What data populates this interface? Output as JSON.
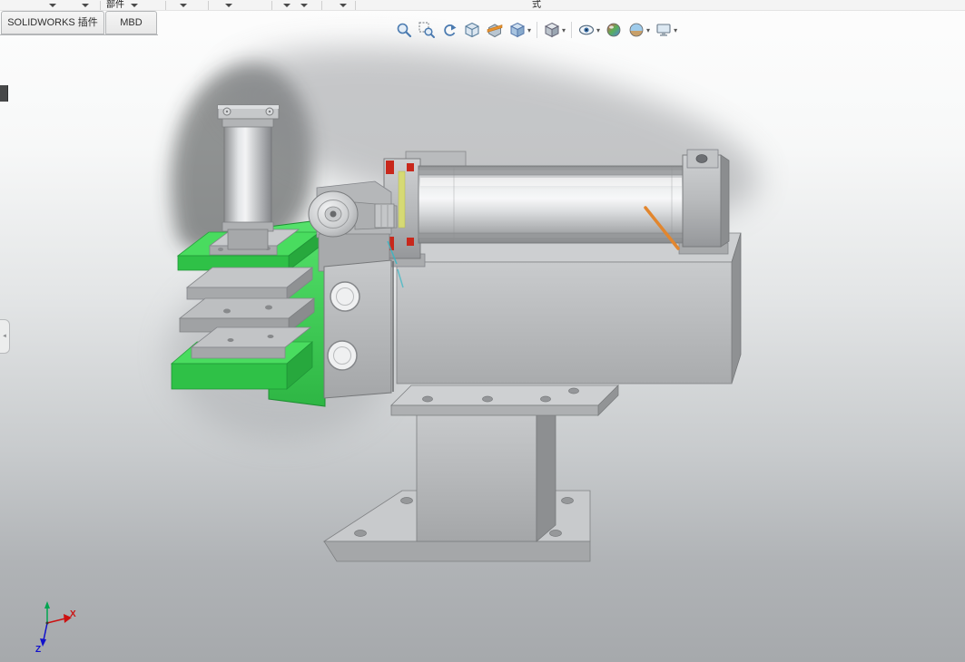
{
  "command_bar": {
    "component_label": "部件",
    "mode_label": "式"
  },
  "tab_bar": {
    "tabs": [
      {
        "label": "SOLIDWORKS 插件",
        "active": true
      },
      {
        "label": "MBD",
        "active": false
      }
    ]
  },
  "heads_up_toolbar": {
    "items": [
      {
        "name": "zoom-to-fit",
        "dropdown": false
      },
      {
        "name": "zoom-to-area",
        "dropdown": false
      },
      {
        "name": "previous-view",
        "dropdown": false
      },
      {
        "name": "dynamic-annotation-views",
        "dropdown": false
      },
      {
        "name": "section-view",
        "dropdown": false
      },
      {
        "name": "view-orientation",
        "dropdown": true
      },
      {
        "name": "display-style",
        "dropdown": true
      },
      {
        "name": "hide-show-items",
        "dropdown": true
      },
      {
        "name": "edit-appearance",
        "dropdown": false
      },
      {
        "name": "apply-scene",
        "dropdown": true
      },
      {
        "name": "view-settings",
        "dropdown": true
      }
    ]
  },
  "viewport": {
    "triad": {
      "x_label": "X",
      "z_label": "Z"
    },
    "model_colors": {
      "highlight_green": "#3ed157",
      "metal_light": "#d5d7d9",
      "metal_mid": "#b4b6b8",
      "metal_dark": "#8e9092",
      "accent_red": "#c8281c",
      "accent_orange": "#e2862e",
      "accent_yellow": "#d6da74",
      "edge_cyan": "#35b8c6"
    }
  }
}
